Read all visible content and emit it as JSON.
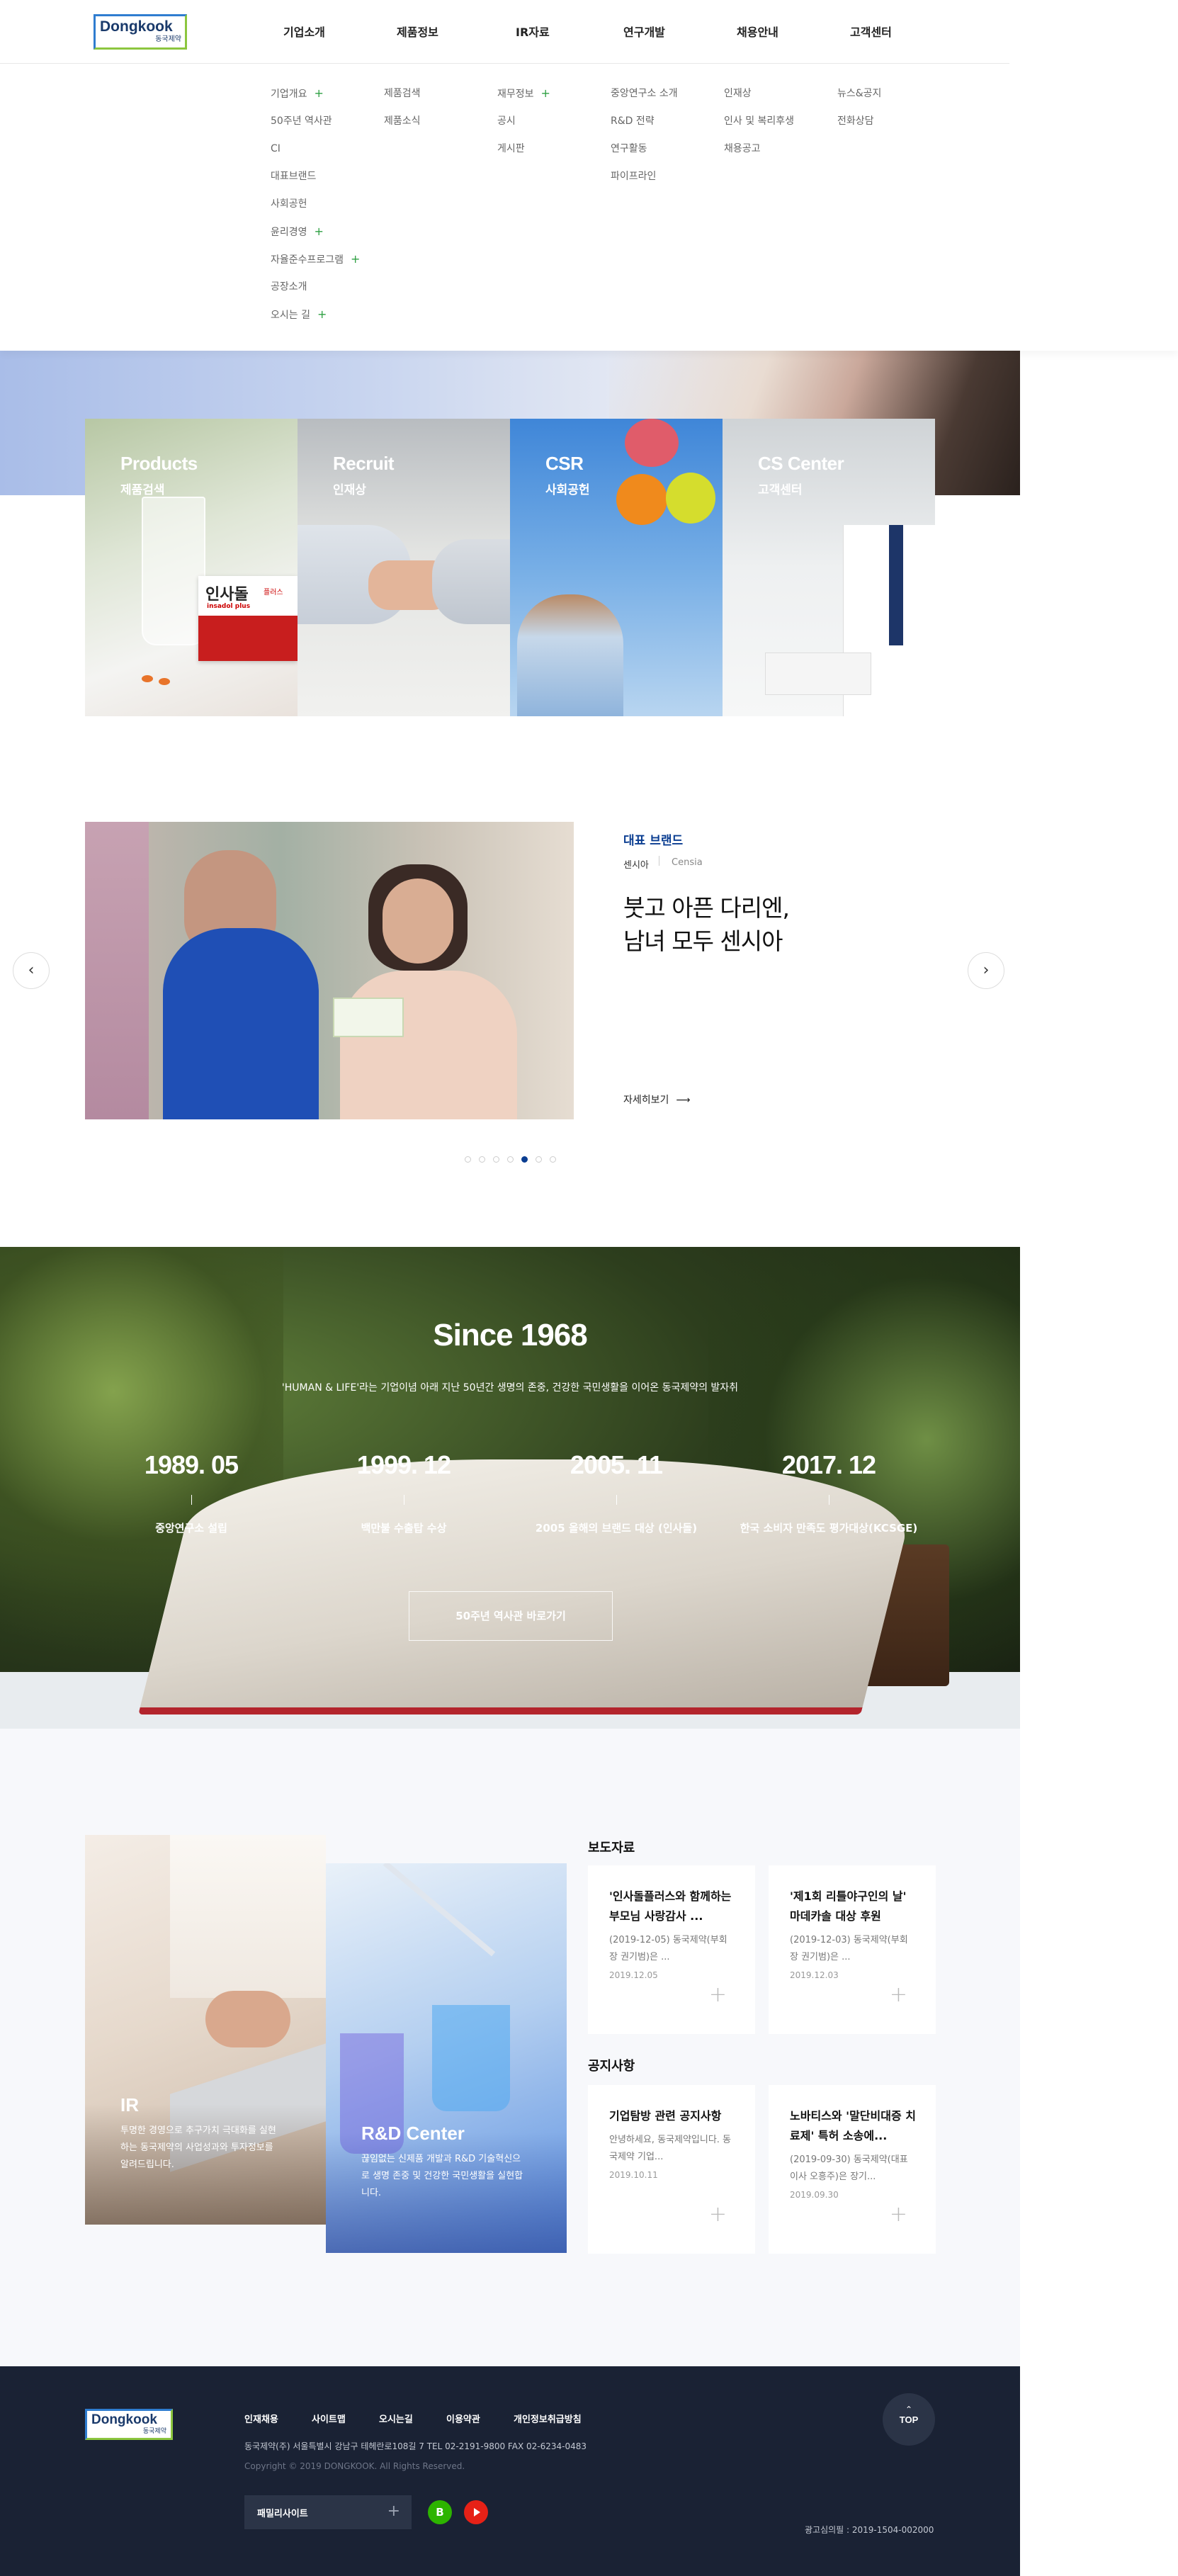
{
  "header": {
    "logo_en": "Dongkook",
    "logo_ko": "동국제약",
    "menu": [
      {
        "label": "기업소개",
        "items": [
          "기업개요",
          "50주년 역사관",
          "CI",
          "대표브랜드",
          "사회공헌",
          "윤리경영",
          "자율준수프로그램",
          "공장소개",
          "오시는 길"
        ]
      },
      {
        "label": "제품정보",
        "items": [
          "제품검색",
          "제품소식"
        ]
      },
      {
        "label": "IR자료",
        "items": [
          "재무정보",
          "공시",
          "게시판"
        ]
      },
      {
        "label": "연구개발",
        "items": [
          "중앙연구소 소개",
          "R&D 전략",
          "연구활동",
          "파이프라인"
        ]
      },
      {
        "label": "채용안내",
        "items": [
          "인재상",
          "인사 및 복리후생",
          "채용공고"
        ]
      },
      {
        "label": "고객센터",
        "items": [
          "뉴스&공지",
          "전화상담"
        ]
      }
    ]
  },
  "quick_cards": [
    {
      "en": "Products",
      "ko": "제품검색"
    },
    {
      "en": "Recruit",
      "ko": "인재상"
    },
    {
      "en": "CSR",
      "ko": "사회공헌"
    },
    {
      "en": "CS Center",
      "ko": "고객센터"
    }
  ],
  "product_box": {
    "brand": "인사돌",
    "sub": "플러스",
    "en": "insadol plus"
  },
  "brand": {
    "section_label": "대표 브랜드",
    "tag_ko": "센시아",
    "tag_en": "Censia",
    "headline_1": "붓고 아픈 다리엔,",
    "headline_2": "남녀 모두 센시아",
    "more": "자세히보기",
    "prev_icon": "‹",
    "next_icon": "›",
    "dot_count": 7,
    "active_dot": 5
  },
  "history": {
    "title": "Since 1968",
    "subtitle": "'HUMAN & LIFE'라는 기업이념 아래 지난 50년간 생명의 존중, 건강한 국민생활을 이어온 동국제약의 발자취",
    "milestones": [
      {
        "year": "1989. 05",
        "desc": "중앙연구소 설립"
      },
      {
        "year": "1999. 12",
        "desc": "백만불 수출탑 수상"
      },
      {
        "year": "2005. 11",
        "desc": "2005 올해의 브랜드 대상 (인사돌)"
      },
      {
        "year": "2017. 12",
        "desc": "한국 소비자 만족도 평가대상(KCSGE)"
      }
    ],
    "button": "50주년 역사관 바로가기"
  },
  "promo": {
    "ir_title": "IR",
    "ir_desc": "투명한 경영으로 추구가치 극대화를 실현하는 동국제약의 사업성과와 투자정보를 알려드립니다.",
    "rd_title": "R&D Center",
    "rd_desc": "끊임없는 신제품 개발과 R&D 기술혁신으로 생명 존중 및 건강한 국민생활을 실현합니다."
  },
  "press": {
    "title": "보도자료",
    "items": [
      {
        "title": "'인사돌플러스와 함께하는 부모님 사랑감사 ...",
        "summary": "(2019-12-05) 동국제약(부회장 권기범)은 ...",
        "date": "2019.12.05"
      },
      {
        "title": "'제1회 리틀야구인의 날' 마데카솔 대상 후원",
        "summary": "(2019-12-03) 동국제약(부회장 권기범)은 ...",
        "date": "2019.12.03"
      }
    ]
  },
  "notice": {
    "title": "공지사항",
    "items": [
      {
        "title": "기업탐방 관련 공지사항",
        "summary": "안녕하세요, 동국제약입니다. 동국제약 기업...",
        "date": "2019.10.11"
      },
      {
        "title": "노바티스와 '말단비대증 치료제' 특허 소송에...",
        "summary": "(2019-09-30) 동국제약(대표이사 오흥주)은 장기...",
        "date": "2019.09.30"
      }
    ]
  },
  "footer": {
    "logo_en": "Dongkook",
    "logo_ko": "동국제약",
    "links": [
      "인재채용",
      "사이트맵",
      "오시는길",
      "이용약관",
      "개인정보취급방침"
    ],
    "address": "동국제약(주) 서울특별시 강남구 테헤란로108길 7   TEL 02-2191-9800   FAX 02-6234-0483",
    "copyright": "Copyright © 2019 DONGKOOK. All Rights Reserved.",
    "family_site": "패밀리사이트",
    "blog_icon": "B",
    "top": "TOP",
    "ad_review": "광고심의필 : 2019-1504-002000"
  },
  "colors": {
    "navy": "#1a2234",
    "brand_blue": "#1a3a6b",
    "accent_blue": "#0a3d91",
    "green": "#2ea043"
  }
}
